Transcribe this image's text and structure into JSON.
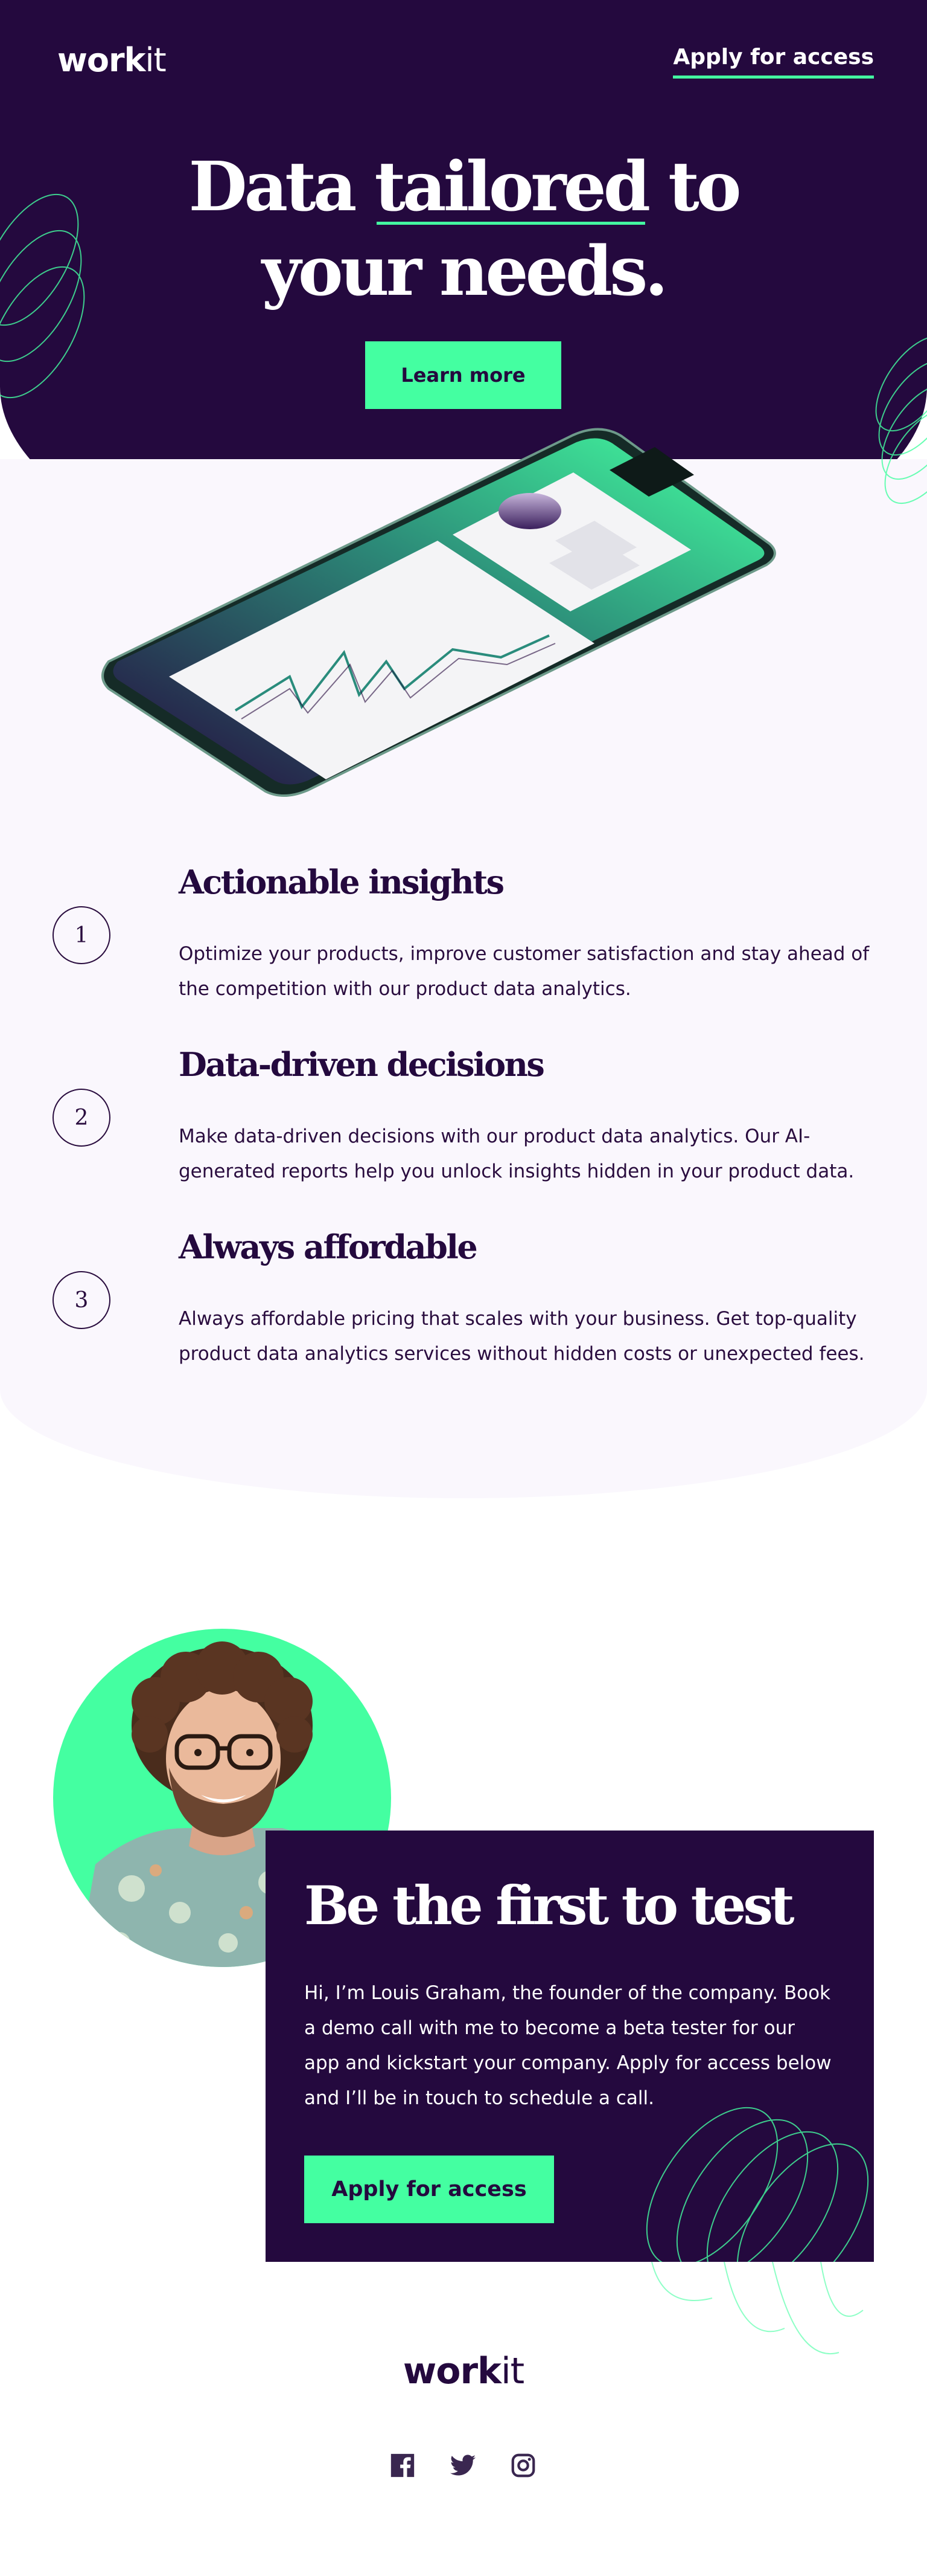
{
  "header": {
    "logo_bold": "work",
    "logo_light": "it",
    "nav_apply": "Apply for access"
  },
  "hero": {
    "title_line1_a": "Data ",
    "title_line1_u": "tailored",
    "title_line1_b": " to",
    "title_line2": "your needs.",
    "cta": "Learn more"
  },
  "features": [
    {
      "number": "1",
      "title": "Actionable insights",
      "text": "Optimize your products, improve customer satisfaction and stay ahead of the competition with our product data analytics."
    },
    {
      "number": "2",
      "title": "Data-driven decisions",
      "text": "Make data-driven decisions with our product data analytics. Our AI-generated reports help you unlock insights hidden in your product data."
    },
    {
      "number": "3",
      "title": "Always affordable",
      "text": "Always affordable pricing that scales with your business. Get top-quality product data analytics services without hidden costs or unexpected fees."
    }
  ],
  "founder": {
    "title": "Be the first to test",
    "text": "Hi, I’m Louis Graham, the founder of the company. Book a demo call with me to become a beta tester for our app and kickstart your company. Apply for access below and I’ll be in touch to schedule a call.",
    "cta": "Apply for access"
  },
  "footer": {
    "logo_bold": "work",
    "logo_light": "it",
    "socials": [
      "facebook-icon",
      "twitter-icon",
      "instagram-icon"
    ]
  },
  "colors": {
    "brand_dark": "#24093e",
    "accent": "#44ffa1",
    "light_bg": "#faf7fd"
  }
}
